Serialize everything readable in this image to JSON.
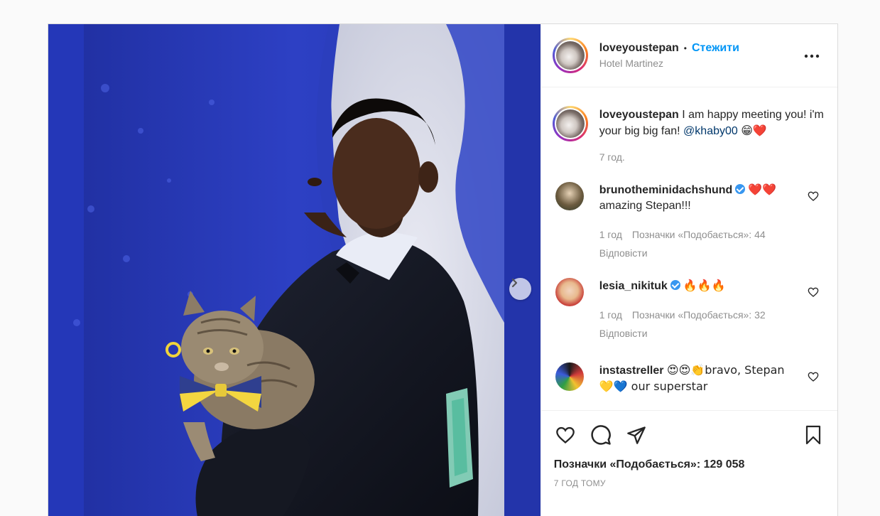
{
  "post": {
    "author": "loveyoustepan",
    "follow_label": "Стежити",
    "separator": "•",
    "location": "Hotel Martinez",
    "more_icon": "more-horizontal-icon"
  },
  "caption": {
    "username": "loveyoustepan",
    "text": " I am happy meeting you! i'm your big big fan! ",
    "mention": "@khaby00",
    "emojis": "😁❤️",
    "time": "7 год."
  },
  "comments": [
    {
      "username": "brunotheminidachshund",
      "verified": true,
      "line1_suffix": "❤️❤️",
      "text": "amazing Stepan!!!",
      "time": "1 год",
      "likes": "Позначки «Подобається»: 44",
      "reply": "Відповісти"
    },
    {
      "username": "lesia_nikituk",
      "verified": true,
      "line1_suffix": "🔥🔥🔥",
      "text": "",
      "time": "1 год",
      "likes": "Позначки «Подобається»: 32",
      "reply": "Відповісти"
    },
    {
      "username": "instastreller",
      "verified": false,
      "line1_suffix": "😍😍👏bravo, Stepan",
      "text": "💛💙 our superstar",
      "time": "",
      "likes": "",
      "reply": ""
    }
  ],
  "footer": {
    "likes_text": "Позначки «Подобається»: 129 058",
    "time_ago": "7 ГОД ТОМУ"
  },
  "colors": {
    "accent": "#0095f6",
    "mention": "#00376b",
    "verified": "#3897f0",
    "photo_bg": "#2a3bb5"
  }
}
